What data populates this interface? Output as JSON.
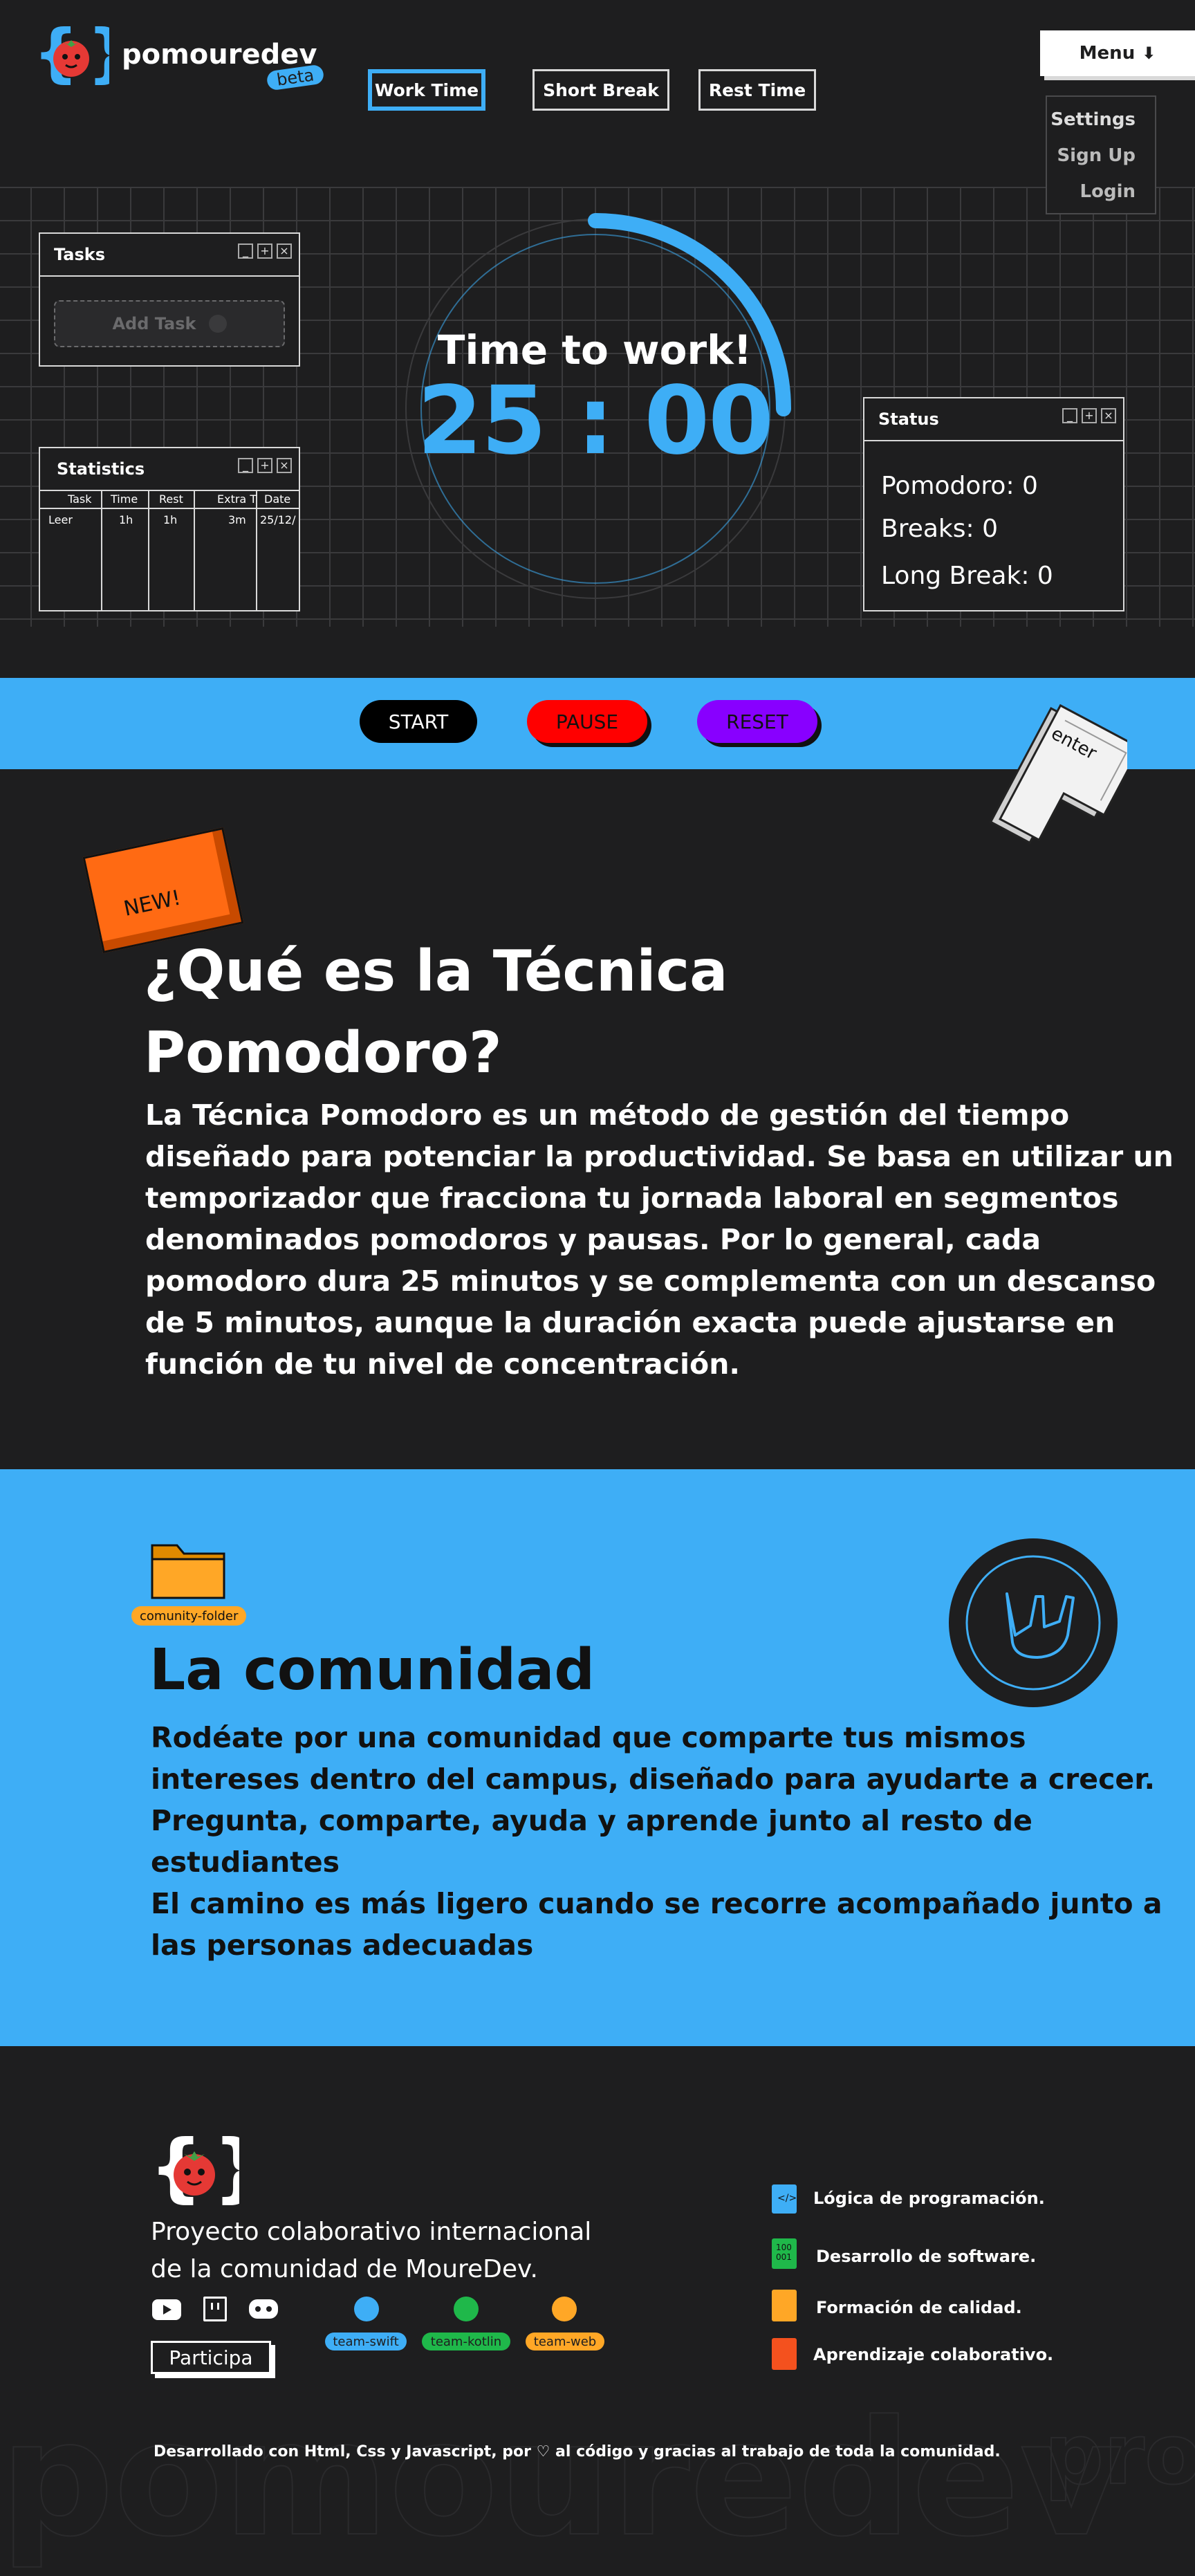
{
  "header": {
    "brand": "pomouredev",
    "badge": "beta",
    "modes": [
      "Work Time",
      "Short  Break",
      "Rest Time"
    ],
    "menu_label": "Menu",
    "menu_items": [
      "Settings",
      "Sign Up",
      "Login"
    ]
  },
  "tasks_window": {
    "title": "Tasks",
    "add_task_label": "Add Task"
  },
  "stats_window": {
    "title": "Statistics",
    "columns": [
      "Task",
      "Time",
      "Rest",
      "Extra T",
      "Date"
    ],
    "rows": [
      [
        "Leer",
        "1h",
        "1h",
        "3m",
        "25/12/"
      ]
    ]
  },
  "timer": {
    "label": "Time to work!",
    "value": "25 : 00",
    "progress": 0.25
  },
  "status_window": {
    "title": "Status",
    "lines": [
      "Pomodoro: 0",
      "Breaks: 0",
      "Long Break: 0"
    ]
  },
  "controls": {
    "start": "START",
    "pause": "PAUSE",
    "reset": "RESET",
    "key_label": "enter"
  },
  "pomodoro_section": {
    "badge": "NEW!",
    "title_line1": "¿Qué es la Técnica",
    "title_line2": "Pomodoro?",
    "body": [
      "La Técnica Pomodoro es un método de gestión del tiempo",
      "diseñado para potenciar la productividad. Se basa en utilizar un",
      "temporizador que fracciona tu jornada laboral en segmentos",
      "denominados pomodoros y pausas. Por lo general, cada",
      "pomodoro dura 25 minutos y se complementa con un descanso",
      "de 5 minutos, aunque la duración exacta puede ajustarse en",
      "función de tu nivel de concentración."
    ]
  },
  "community_section": {
    "folder_label": "comunity-folder",
    "title": "La comunidad",
    "body": [
      "Rodéate por una comunidad que comparte tus mismos",
      "intereses dentro del campus, diseñado para ayudarte a crecer.",
      "Pregunta, comparte, ayuda y aprende junto al resto de",
      "estudiantes",
      "El camino es más ligero cuando se recorre acompañado junto a",
      "las personas adecuadas"
    ]
  },
  "footer": {
    "tagline_line1": "Proyecto colaborativo internacional",
    "tagline_line2": "de la comunidad de MoureDev.",
    "participate": "Participa",
    "teams": [
      "team-swift",
      "team-kotlin",
      "team-web"
    ],
    "features": [
      "Lógica de programación.",
      "Desarrollo de software.",
      "Formación de calidad.",
      "Aprendizaje colaborativo."
    ],
    "credits": "Desarrollado  con Html, Css y Javascript, por ♡ al  código y gracias al trabajo de toda la comunidad.",
    "watermark": "pomouredev",
    "watermark_suffix": "pro"
  },
  "colors": {
    "accent": "#3eaef6",
    "background": "#1e1e1f",
    "pause": "#ff0000",
    "reset": "#8800ff",
    "new_badge": "#ff6a13",
    "folder": "#ffa726"
  }
}
